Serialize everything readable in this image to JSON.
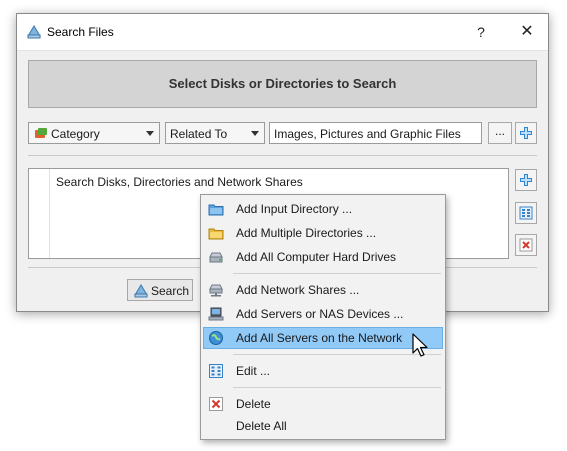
{
  "window": {
    "title": "Search Files",
    "help_label": "?",
    "close_label": "✕"
  },
  "banner": {
    "text": "Select Disks or Directories to Search"
  },
  "filters": {
    "category_label": "Category",
    "relation_label": "Related To",
    "value": "Images, Pictures and Graphic Files",
    "browse_label": "..."
  },
  "list": {
    "items": [
      "Search Disks, Directories and Network Shares"
    ]
  },
  "footer": {
    "search_label": "Search"
  },
  "context_menu": {
    "items": [
      {
        "label": "Add Input Directory ...",
        "icon": "folder-blue-icon"
      },
      {
        "label": "Add Multiple Directories ...",
        "icon": "folder-yellow-icon"
      },
      {
        "label": "Add All Computer Hard Drives",
        "icon": "hard-drive-icon"
      },
      {
        "label": "Add Network Shares ...",
        "icon": "network-share-icon"
      },
      {
        "label": "Add Servers or NAS Devices ...",
        "icon": "server-icon"
      },
      {
        "label": "Add All Servers on the Network",
        "icon": "globe-icon",
        "highlighted": true
      },
      {
        "label": "Edit ...",
        "icon": "edit-icon"
      },
      {
        "label": "Delete",
        "icon": "delete-icon"
      },
      {
        "label": "Delete All",
        "icon": ""
      }
    ]
  },
  "colors": {
    "highlight": "#91c9f7",
    "accent_blue": "#2f86d6",
    "delete_red": "#d43b2f"
  }
}
